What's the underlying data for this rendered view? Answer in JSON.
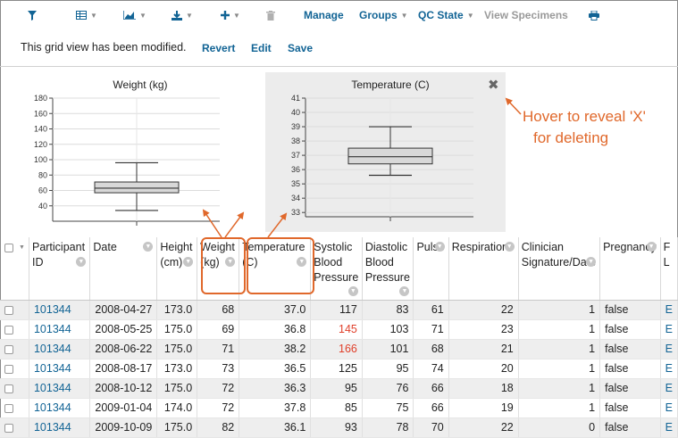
{
  "toolbar": {
    "icons": [
      "filter-icon",
      "grid-icon",
      "chart-icon",
      "download-icon",
      "plus-icon",
      "trash-icon",
      "print-icon"
    ],
    "manage_label": "Manage",
    "groups_label": "Groups",
    "qc_state_label": "QC State",
    "view_specimens_label": "View Specimens"
  },
  "message": {
    "text": "This grid view has been modified.",
    "revert_label": "Revert",
    "edit_label": "Edit",
    "save_label": "Save"
  },
  "annotation": {
    "line1": "Hover to reveal 'X'",
    "line2": "for deleting",
    "color": "#e0682b"
  },
  "chart_data": [
    {
      "type": "box",
      "title": "Weight (kg)",
      "ylim": [
        20,
        180
      ],
      "yticks": [
        "180",
        "160",
        "140",
        "120",
        "100",
        "80",
        "60",
        "40"
      ],
      "box": {
        "min": 34,
        "q1": 57,
        "median": 63,
        "q3": 71,
        "max": 96
      }
    },
    {
      "type": "box",
      "title": "Temperature (C)",
      "ylim": [
        32.7,
        41
      ],
      "yticks": [
        "41",
        "40",
        "39",
        "38",
        "37",
        "36",
        "35",
        "34",
        "33"
      ],
      "box": {
        "min": 35.6,
        "q1": 36.4,
        "median": 36.9,
        "q3": 37.5,
        "max": 39
      }
    }
  ],
  "columns": [
    {
      "label": "",
      "sortable": false
    },
    {
      "label": "Participant ID",
      "lines": [
        "Participant",
        "ID"
      ]
    },
    {
      "label": "Date",
      "lines": [
        "Date"
      ]
    },
    {
      "label": "Height (cm)",
      "lines": [
        "Height",
        "(cm)"
      ]
    },
    {
      "label": "Weight (kg)",
      "lines": [
        "Weight",
        "(kg)"
      ]
    },
    {
      "label": "Temperature (C)",
      "lines": [
        "Temperature",
        "(C)"
      ]
    },
    {
      "label": "Systolic Blood Pressure",
      "lines": [
        "Systolic",
        "Blood",
        "Pressure"
      ]
    },
    {
      "label": "Diastolic Blood Pressure",
      "lines": [
        "Diastolic",
        "Blood",
        "Pressure"
      ]
    },
    {
      "label": "Pulse",
      "lines": [
        "Pulse"
      ]
    },
    {
      "label": "Respirations",
      "lines": [
        "Respirations"
      ]
    },
    {
      "label": "Clinician Signature/Date",
      "lines": [
        "Clinician",
        "Signature/Date"
      ]
    },
    {
      "label": "Pregnancy",
      "lines": [
        "Pregnancy"
      ]
    },
    {
      "label": "F L",
      "lines": [
        "F",
        "L"
      ]
    }
  ],
  "rows": [
    {
      "participant": "101344",
      "date": "2008-04-27",
      "height": "173.0",
      "weight": "68",
      "temp": "37.0",
      "systolic": "117",
      "systolic_flag": false,
      "diastolic": "83",
      "pulse": "61",
      "resp": "22",
      "clinician": "1",
      "pregnancy": "false",
      "extra": "E"
    },
    {
      "participant": "101344",
      "date": "2008-05-25",
      "height": "175.0",
      "weight": "69",
      "temp": "36.8",
      "systolic": "145",
      "systolic_flag": true,
      "diastolic": "103",
      "pulse": "71",
      "resp": "23",
      "clinician": "1",
      "pregnancy": "false",
      "extra": "E"
    },
    {
      "participant": "101344",
      "date": "2008-06-22",
      "height": "175.0",
      "weight": "71",
      "temp": "38.2",
      "systolic": "166",
      "systolic_flag": true,
      "diastolic": "101",
      "pulse": "68",
      "resp": "21",
      "clinician": "1",
      "pregnancy": "false",
      "extra": "E"
    },
    {
      "participant": "101344",
      "date": "2008-08-17",
      "height": "173.0",
      "weight": "73",
      "temp": "36.5",
      "systolic": "125",
      "systolic_flag": false,
      "diastolic": "95",
      "pulse": "74",
      "resp": "20",
      "clinician": "1",
      "pregnancy": "false",
      "extra": "E"
    },
    {
      "participant": "101344",
      "date": "2008-10-12",
      "height": "175.0",
      "weight": "72",
      "temp": "36.3",
      "systolic": "95",
      "systolic_flag": false,
      "diastolic": "76",
      "pulse": "66",
      "resp": "18",
      "clinician": "1",
      "pregnancy": "false",
      "extra": "E"
    },
    {
      "participant": "101344",
      "date": "2009-01-04",
      "height": "174.0",
      "weight": "72",
      "temp": "37.8",
      "systolic": "85",
      "systolic_flag": false,
      "diastolic": "75",
      "pulse": "66",
      "resp": "19",
      "clinician": "1",
      "pregnancy": "false",
      "extra": "E"
    },
    {
      "participant": "101344",
      "date": "2009-10-09",
      "height": "175.0",
      "weight": "82",
      "temp": "36.1",
      "systolic": "93",
      "systolic_flag": false,
      "diastolic": "78",
      "pulse": "70",
      "resp": "22",
      "clinician": "0",
      "pregnancy": "false",
      "extra": "E"
    }
  ]
}
